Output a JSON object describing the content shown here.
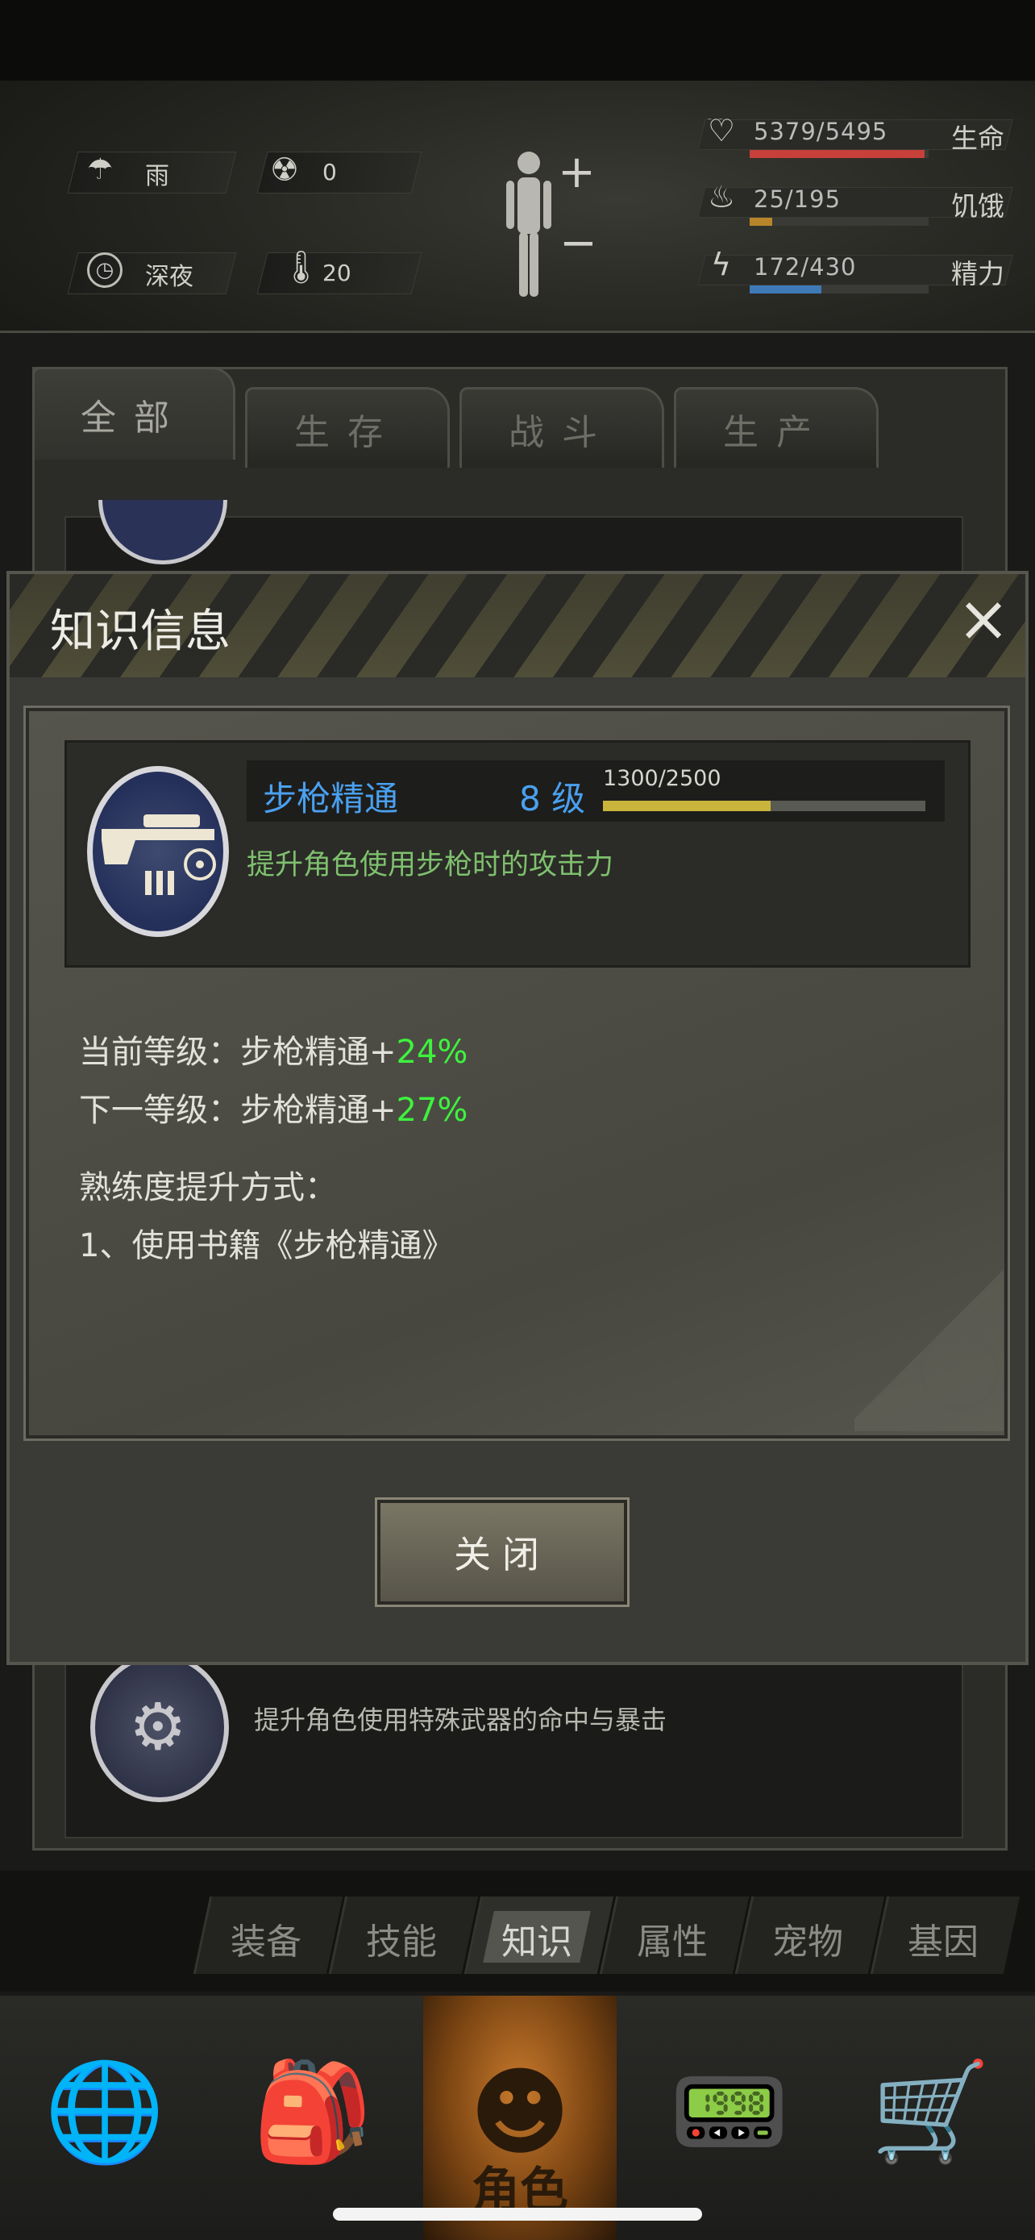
{
  "status": {
    "weather": "雨",
    "radiation": "0",
    "time_of_day": "深夜",
    "temperature": "20",
    "health_value": "5379/5495",
    "health_label": "生命",
    "health_fraction": 0.979,
    "hunger_value": "25/195",
    "hunger_label": "饥饿",
    "hunger_fraction": 0.128,
    "energy_value": "172/430",
    "energy_label": "精力",
    "energy_fraction": 0.4,
    "colors": {
      "health": "#c7403a",
      "hunger": "#b8862a",
      "energy": "#3e7ab8"
    }
  },
  "tabs": [
    {
      "label": "全部",
      "active": true
    },
    {
      "label": "生存",
      "active": false
    },
    {
      "label": "战斗",
      "active": false
    },
    {
      "label": "生产",
      "active": false
    }
  ],
  "list": {
    "bottom_item_desc": "提升角色使用特殊武器的命中与暴击"
  },
  "modal": {
    "title": "知识信息",
    "close_icon": "close-icon",
    "skill": {
      "name": "步枪精通",
      "level": "8 级",
      "xp": "1300/2500",
      "xp_fraction": 0.52,
      "description": "提升角色使用步枪时的攻击力"
    },
    "current_label": "当前等级：步枪精通+",
    "current_value": "24%",
    "next_label": "下一等级：步枪精通+",
    "next_value": "27%",
    "method_title": "熟练度提升方式：",
    "method_1": "1、使用书籍《步枪精通》",
    "close_button": "关闭"
  },
  "subtabs": [
    {
      "label": "装备",
      "active": false
    },
    {
      "label": "技能",
      "active": false
    },
    {
      "label": "知识",
      "active": true
    },
    {
      "label": "属性",
      "active": false
    },
    {
      "label": "宠物",
      "active": false
    },
    {
      "label": "基因",
      "active": false
    }
  ],
  "nav": {
    "items": [
      "globe-icon",
      "backpack-icon",
      "character-icon",
      "radio-icon",
      "cart-icon"
    ],
    "active_label": "角色"
  }
}
